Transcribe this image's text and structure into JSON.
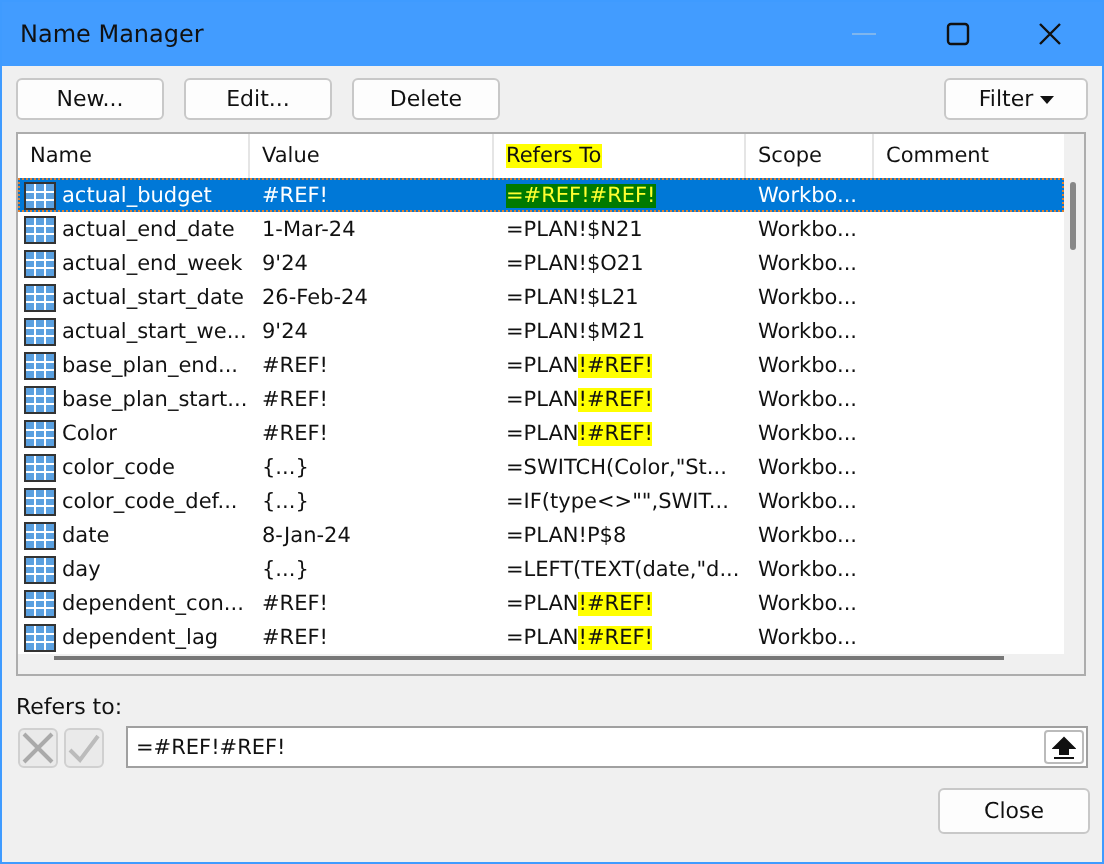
{
  "window": {
    "title": "Name Manager"
  },
  "buttons": [
    {
      "label": "New..."
    },
    {
      "label": "Edit..."
    },
    {
      "label": "Delete"
    }
  ],
  "filter_button": {
    "label": "Filter"
  },
  "table": {
    "columns": [
      {
        "label": "Name",
        "highlighted": false
      },
      {
        "label": "Value",
        "highlighted": false
      },
      {
        "label": "Refers To",
        "highlighted": true
      },
      {
        "label": "Scope",
        "highlighted": false
      },
      {
        "label": "Comment",
        "highlighted": false
      }
    ],
    "rows": [
      {
        "name": "actual_budget",
        "value": "#REF!",
        "refers_to": [
          {
            "text": "=#REF!#REF!",
            "highlighted": true
          }
        ],
        "scope": "Workbo...",
        "selected": true
      },
      {
        "name": "actual_end_date",
        "value": "1-Mar-24",
        "refers_to": [
          {
            "text": "=PLAN!$N21",
            "highlighted": false
          }
        ],
        "scope": "Workbo...",
        "selected": false
      },
      {
        "name": "actual_end_week",
        "value": "9'24",
        "refers_to": [
          {
            "text": "=PLAN!$O21",
            "highlighted": false
          }
        ],
        "scope": "Workbo...",
        "selected": false
      },
      {
        "name": "actual_start_date",
        "value": "26-Feb-24",
        "refers_to": [
          {
            "text": "=PLAN!$L21",
            "highlighted": false
          }
        ],
        "scope": "Workbo...",
        "selected": false
      },
      {
        "name": "actual_start_we...",
        "value": "9'24",
        "refers_to": [
          {
            "text": "=PLAN!$M21",
            "highlighted": false
          }
        ],
        "scope": "Workbo...",
        "selected": false
      },
      {
        "name": "base_plan_end...",
        "value": "#REF!",
        "refers_to": [
          {
            "text": "=PLAN",
            "highlighted": false
          },
          {
            "text": "!#REF!",
            "highlighted": true
          }
        ],
        "scope": "Workbo...",
        "selected": false
      },
      {
        "name": "base_plan_start...",
        "value": "#REF!",
        "refers_to": [
          {
            "text": "=PLAN",
            "highlighted": false
          },
          {
            "text": "!#REF!",
            "highlighted": true
          }
        ],
        "scope": "Workbo...",
        "selected": false
      },
      {
        "name": "Color",
        "value": "#REF!",
        "refers_to": [
          {
            "text": "=PLAN",
            "highlighted": false
          },
          {
            "text": "!#REF!",
            "highlighted": true
          }
        ],
        "scope": "Workbo...",
        "selected": false
      },
      {
        "name": "color_code",
        "value": "{...}",
        "refers_to": [
          {
            "text": "=SWITCH(Color,\"St...",
            "highlighted": false
          }
        ],
        "scope": "Workbo...",
        "selected": false
      },
      {
        "name": "color_code_def...",
        "value": "{...}",
        "refers_to": [
          {
            "text": "=IF(type<>\"\",SWIT...",
            "highlighted": false
          }
        ],
        "scope": "Workbo...",
        "selected": false
      },
      {
        "name": "date",
        "value": "8-Jan-24",
        "refers_to": [
          {
            "text": "=PLAN!P$8",
            "highlighted": false
          }
        ],
        "scope": "Workbo...",
        "selected": false
      },
      {
        "name": "day",
        "value": "{...}",
        "refers_to": [
          {
            "text": "=LEFT(TEXT(date,\"d...",
            "highlighted": false
          }
        ],
        "scope": "Workbo...",
        "selected": false
      },
      {
        "name": "dependent_con...",
        "value": "#REF!",
        "refers_to": [
          {
            "text": "=PLAN",
            "highlighted": false
          },
          {
            "text": "!#REF!",
            "highlighted": true
          }
        ],
        "scope": "Workbo...",
        "selected": false
      },
      {
        "name": "dependent_lag",
        "value": "#REF!",
        "refers_to": [
          {
            "text": "=PLAN",
            "highlighted": false
          },
          {
            "text": "!#REF!",
            "highlighted": true
          }
        ],
        "scope": "Workbo...",
        "selected": false
      }
    ]
  },
  "refers_to": {
    "label": "Refers to:",
    "value": "=#REF!#REF!"
  },
  "close_button": {
    "label": "Close"
  }
}
